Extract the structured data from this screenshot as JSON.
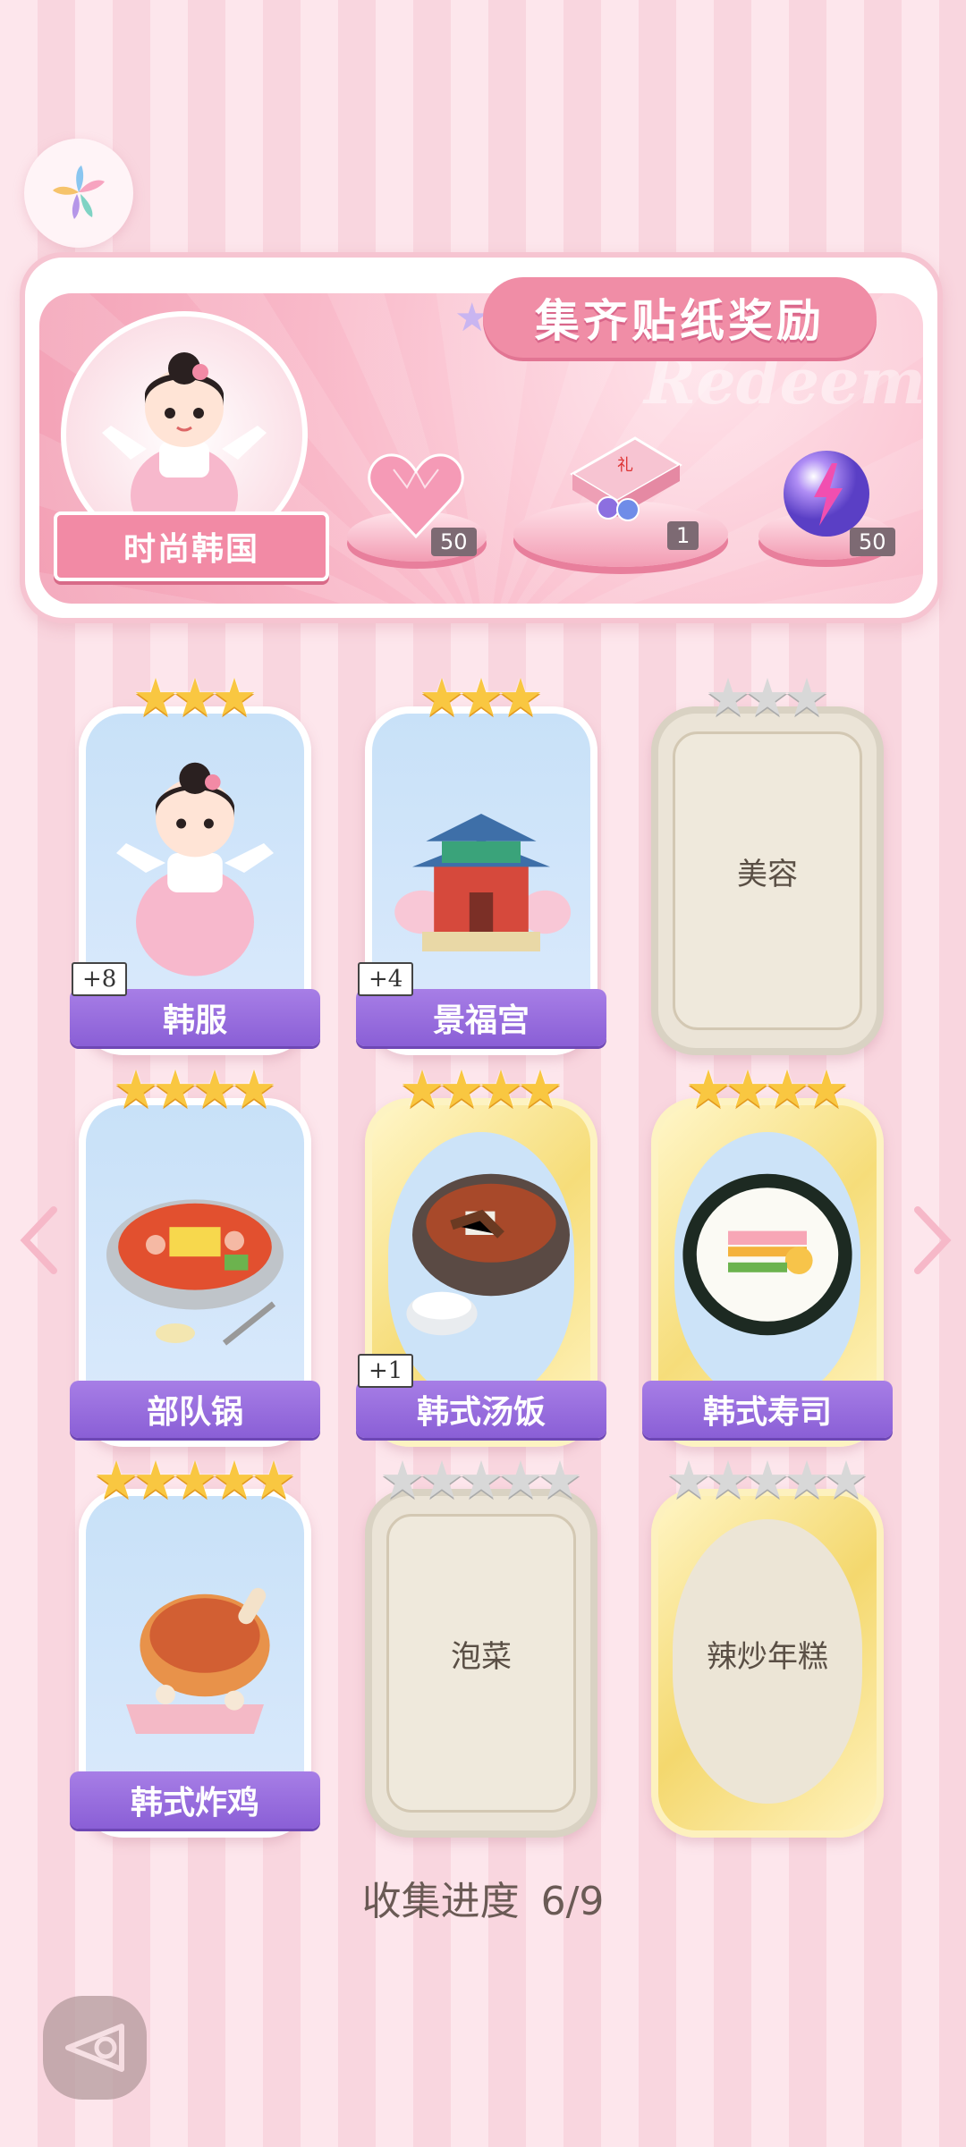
{
  "banner": {
    "title": "集齐贴纸奖励",
    "watermark": "Redeem",
    "theme_label": "时尚韩国",
    "rewards": [
      {
        "icon": "heart-gem-icon",
        "count": "50"
      },
      {
        "icon": "gift-box-icon",
        "count": "1"
      },
      {
        "icon": "energy-orb-icon",
        "count": "50"
      }
    ]
  },
  "cards": [
    {
      "name": "韩服",
      "stars": 3,
      "unlocked": true,
      "bonus": "+8",
      "style": "blue",
      "art": "hanbok-girl"
    },
    {
      "name": "景福宫",
      "stars": 3,
      "unlocked": true,
      "bonus": "+4",
      "style": "blue",
      "art": "palace"
    },
    {
      "name": "美容",
      "stars": 3,
      "unlocked": false,
      "bonus": "",
      "style": "locked",
      "art": ""
    },
    {
      "name": "部队锅",
      "stars": 4,
      "unlocked": true,
      "bonus": "",
      "style": "blue",
      "art": "army-stew"
    },
    {
      "name": "韩式汤饭",
      "stars": 4,
      "unlocked": true,
      "bonus": "+1",
      "style": "gold",
      "art": "soup-rice"
    },
    {
      "name": "韩式寿司",
      "stars": 4,
      "unlocked": true,
      "bonus": "",
      "style": "gold",
      "art": "kimbap"
    },
    {
      "name": "韩式炸鸡",
      "stars": 5,
      "unlocked": true,
      "bonus": "",
      "style": "blue",
      "art": "fried-chicken"
    },
    {
      "name": "泡菜",
      "stars": 5,
      "unlocked": false,
      "bonus": "",
      "style": "locked",
      "art": ""
    },
    {
      "name": "辣炒年糕",
      "stars": 5,
      "unlocked": false,
      "bonus": "",
      "style": "locked-gold",
      "art": ""
    }
  ],
  "progress": {
    "label": "收集进度",
    "value": "6/9"
  },
  "nav": {
    "prev_icon": "chevron-left-icon",
    "next_icon": "chevron-right-icon",
    "back_icon": "back-icon"
  }
}
